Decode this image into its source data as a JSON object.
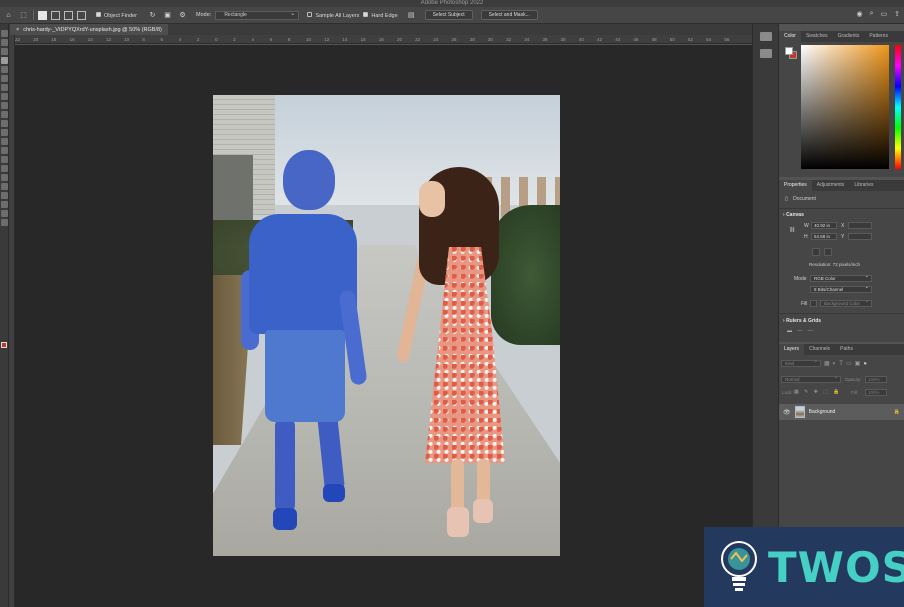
{
  "window": {
    "title": "Adobe Photoshop 2022"
  },
  "options_bar": {
    "object_finder_label": "Object Finder",
    "mode_label": "Mode:",
    "mode_value": "Rectangle",
    "sample_all_layers_label": "Sample All Layers",
    "hard_edge_label": "Hard Edge",
    "select_subject_label": "Select Subject",
    "select_and_mask_label": "Select and Mask...",
    "icons": [
      "home-icon",
      "object-selection-tool-icon",
      "new-selection-icon",
      "add-selection-icon",
      "subtract-selection-icon",
      "intersect-selection-icon",
      "refresh-icon",
      "show-objects-icon",
      "gear-icon",
      "workspace-icon",
      "user-icon",
      "search-icon",
      "frame-icon",
      "share-icon"
    ]
  },
  "document": {
    "tab_label": "chris-hardy-_VtDPYQXrdY-unsplash.jpg @ 50% (RGB/8)",
    "close_icon": "close-icon"
  },
  "ruler": {
    "top_ticks": [
      "22",
      "20",
      "18",
      "16",
      "14",
      "12",
      "10",
      "8",
      "6",
      "4",
      "2",
      "0",
      "2",
      "4",
      "6",
      "8",
      "10",
      "12",
      "14",
      "16",
      "18",
      "20",
      "22",
      "24",
      "26",
      "28",
      "30",
      "32",
      "34",
      "36",
      "38",
      "40",
      "42",
      "44",
      "46",
      "48",
      "50",
      "52",
      "54",
      "56"
    ]
  },
  "color_panel": {
    "tabs": [
      "Color",
      "Swatches",
      "Gradients",
      "Patterns"
    ],
    "active_tab": "Color",
    "foreground_color": "#ffffff",
    "background_color": "#c0392b",
    "field_hue": "#f0961a"
  },
  "properties_panel": {
    "tabs": [
      "Properties",
      "Adjustments",
      "Libraries"
    ],
    "active_tab": "Properties",
    "doc_label": "Document",
    "canvas_header": "Canvas",
    "w_label": "W",
    "w_value": "40.92 in",
    "h_label": "H",
    "h_value": "54.58 in",
    "x_label": "X",
    "y_label": "Y",
    "resolution": "Resolution: 72 pixels/inch",
    "mode_label": "Mode",
    "mode_value": "RGB Color",
    "depth_value": "8 Bits/Channel",
    "fill_label": "Fill",
    "fill_value": "Background Color",
    "rulers_header": "Rulers & Grids"
  },
  "layers_panel": {
    "tabs": [
      "Layers",
      "Channels",
      "Paths"
    ],
    "active_tab": "Layers",
    "kind_placeholder": "Kind",
    "blend_mode": "Normal",
    "opacity_label": "Opacity:",
    "opacity_value": "100%",
    "lock_label": "Lock:",
    "fill_label": "Fill:",
    "fill_value": "100%",
    "layers": [
      {
        "name": "Background",
        "visible": true,
        "locked": true
      }
    ]
  },
  "brand": {
    "text": "TWOS"
  }
}
